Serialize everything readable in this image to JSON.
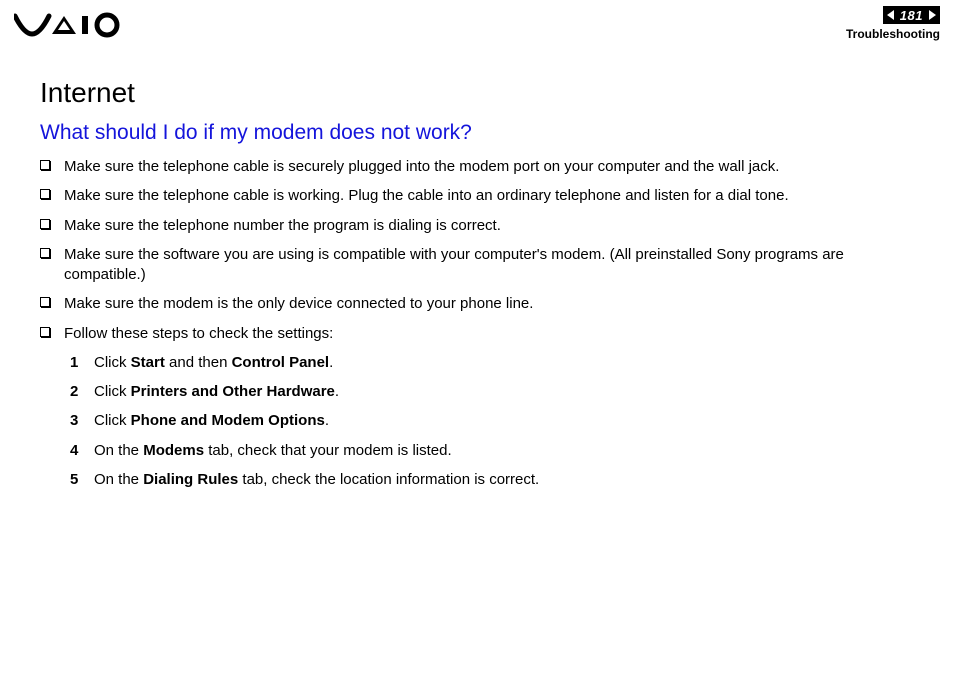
{
  "header": {
    "page_number": "181",
    "section": "Troubleshooting"
  },
  "content": {
    "title": "Internet",
    "subtitle": "What should I do if my modem does not work?",
    "bullets": [
      "Make sure the telephone cable is securely plugged into the modem port on your computer and the wall jack.",
      "Make sure the telephone cable is working. Plug the cable into an ordinary telephone and listen for a dial tone.",
      "Make sure the telephone number the program is dialing is correct.",
      "Make sure the software you are using is compatible with your computer's modem. (All preinstalled Sony programs are compatible.)",
      "Make sure the modem is the only device connected to your phone line.",
      "Follow these steps to check the settings:"
    ],
    "steps": [
      {
        "n": "1",
        "pre": "Click ",
        "b1": "Start",
        "mid": " and then ",
        "b2": "Control Panel",
        "post": "."
      },
      {
        "n": "2",
        "pre": "Click ",
        "b1": "Printers and Other Hardware",
        "mid": "",
        "b2": "",
        "post": "."
      },
      {
        "n": "3",
        "pre": "Click ",
        "b1": "Phone and Modem Options",
        "mid": "",
        "b2": "",
        "post": "."
      },
      {
        "n": "4",
        "pre": "On the ",
        "b1": "Modems",
        "mid": " tab, check that your modem is listed.",
        "b2": "",
        "post": ""
      },
      {
        "n": "5",
        "pre": "On the ",
        "b1": "Dialing Rules",
        "mid": " tab, check the location information is correct.",
        "b2": "",
        "post": ""
      }
    ]
  }
}
